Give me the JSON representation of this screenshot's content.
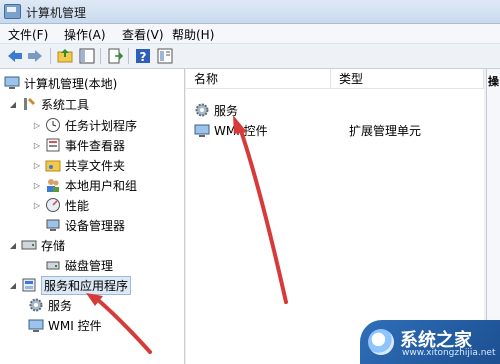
{
  "window": {
    "title": "计算机管理"
  },
  "menu": [
    "文件(F)",
    "操作(A)",
    "查看(V)",
    "帮助(H)"
  ],
  "toolbar": [
    "back-icon",
    "forward-icon",
    "up-folder-icon",
    "show-hide-tree-icon",
    "export-list-icon",
    "help-icon",
    "properties-icon"
  ],
  "tree": {
    "root": "计算机管理(本地)",
    "system_tools": "系统工具",
    "task_scheduler": "任务计划程序",
    "event_viewer": "事件查看器",
    "shared_folders": "共享文件夹",
    "local_users": "本地用户和组",
    "performance": "性能",
    "device_manager": "设备管理器",
    "storage": "存储",
    "disk_management": "磁盘管理",
    "services_apps": "服务和应用程序",
    "services": "服务",
    "wmi": "WMI 控件"
  },
  "list": {
    "headers": {
      "name": "名称",
      "type": "类型"
    },
    "rows": [
      {
        "name": "服务",
        "type": ""
      },
      {
        "name": "WMI 控件",
        "type": "扩展管理单元"
      }
    ]
  },
  "right_pane": {
    "label": "操"
  },
  "watermark": {
    "text": "系统之家",
    "url": "www.xitongzhijia.net"
  },
  "colors": {
    "arrow": "#d83a3a",
    "accent": "#2f6fb8"
  }
}
